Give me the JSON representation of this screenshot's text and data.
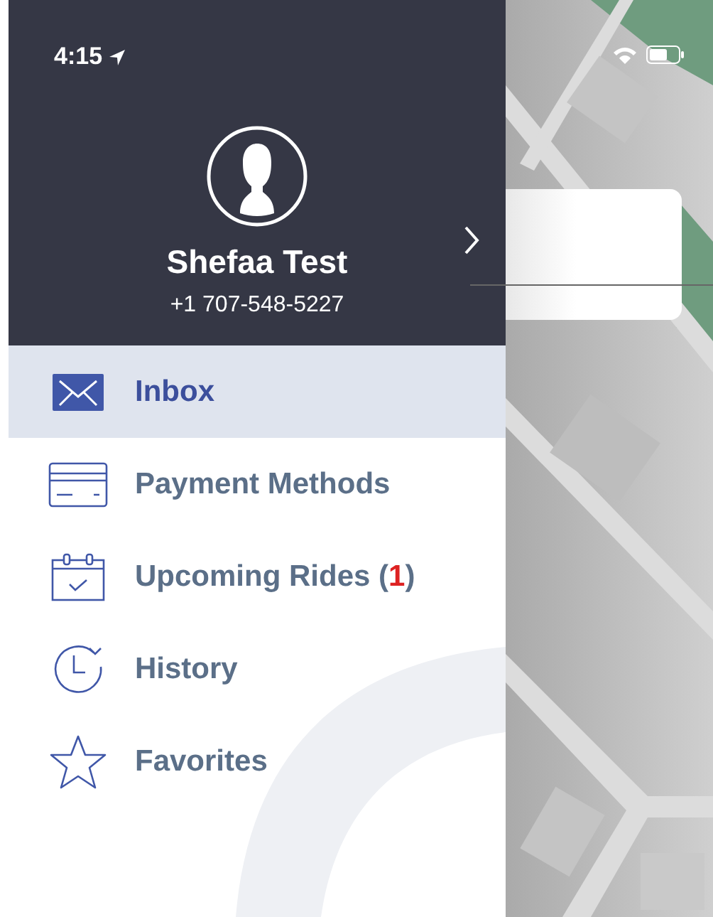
{
  "status_bar": {
    "time": "4:15"
  },
  "profile": {
    "name": "Shefaa Test",
    "phone": "+1 707-548-5227"
  },
  "menu": [
    {
      "label": "Inbox",
      "kind": "envelope",
      "selected": true
    },
    {
      "label": "Payment Methods",
      "kind": "card",
      "selected": false
    },
    {
      "label": "Upcoming Rides",
      "kind": "calendar",
      "selected": false,
      "badge": {
        "open": "(",
        "count": "1",
        "close": ")"
      }
    },
    {
      "label": "History",
      "kind": "clock",
      "selected": false
    },
    {
      "label": "Favorites",
      "kind": "star",
      "selected": false
    }
  ]
}
